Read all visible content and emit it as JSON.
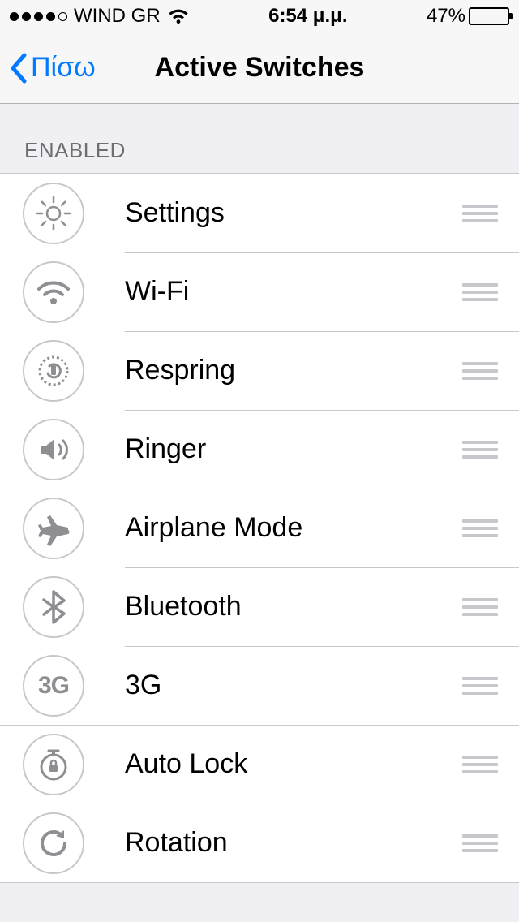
{
  "status": {
    "carrier": "WIND GR",
    "time": "6:54 μ.μ.",
    "battery_pct": "47%",
    "battery_fill": 47
  },
  "nav": {
    "back_label": "Πίσω",
    "title": "Active Switches"
  },
  "section": {
    "header": "ENABLED"
  },
  "rows": [
    {
      "label": "Settings"
    },
    {
      "label": "Wi-Fi"
    },
    {
      "label": "Respring"
    },
    {
      "label": "Ringer"
    },
    {
      "label": "Airplane Mode"
    },
    {
      "label": "Bluetooth"
    },
    {
      "label": "3G"
    },
    {
      "label": "Auto Lock"
    },
    {
      "label": "Rotation"
    }
  ]
}
